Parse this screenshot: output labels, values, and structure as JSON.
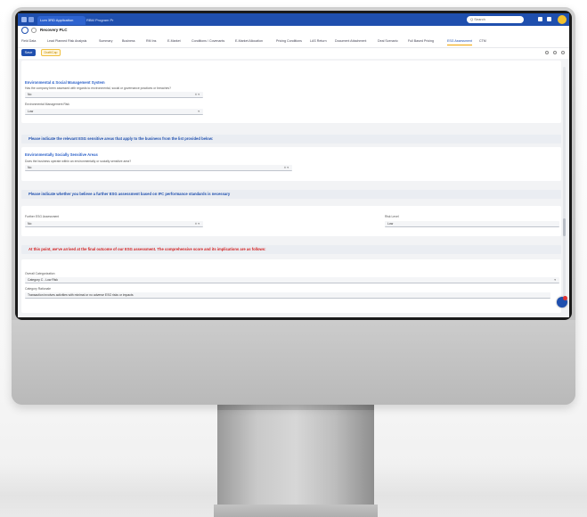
{
  "browser": {
    "tabs": [
      "Lum 3RD Application",
      "RBM Program Pr"
    ],
    "search_placeholder": "Q Search"
  },
  "app": {
    "company": "Recovery PLC",
    "nav_tabs": [
      "Field Data",
      "Lead Planned Risk Analysis",
      "Summary",
      "Business",
      "RM Ins",
      "E-Market",
      "Conditions / Covenants",
      "E-Market Allocation",
      "Pricing Conditions",
      "LAS Return",
      "Document Attachment",
      "Deal Scenario",
      "Full Based Pricing",
      "ESG Assessment",
      "CTM"
    ],
    "active_tab": "ESG Assessment",
    "toolbar": {
      "save_label": "Save",
      "status_label": "Draft/Cap"
    }
  },
  "form": {
    "section_env_title": "Environmental & Social Management System",
    "q_env_1": "Has the company been assessed with regards to environmental, social or governance practices or breaches?",
    "a_env_1": "No",
    "q_env_2": "Environmental Management Risk",
    "a_env_2": "Low",
    "band_1": "Please indicate the relevant ESG sensitive areas that apply to the business from the list provided below:",
    "section_sens_title": "Environmentally Socially Sensitive Areas",
    "q_sens_1": "Does the business operate within an environmentally or socially sensitive area?",
    "a_sens_1": "No",
    "band_2": "Please indicate whether you believe a further ESG assessment based on IFC performance standards is necessary",
    "q_further_label": "Further ESG Assessment",
    "a_further": "No",
    "q_risk_label": "Risk Level",
    "a_risk": "Low",
    "band_3": "At this point, we've arrived at the final outcome of our ESG assessment. The comprehensive score and its implications are as follows:",
    "q_overall_label": "Overall Categorization",
    "a_overall": "Category C - Low Risk",
    "q_reason_label": "Category Rationale",
    "a_reason": "Transaction involves activities with minimal or no adverse ESG risks or impacts"
  }
}
